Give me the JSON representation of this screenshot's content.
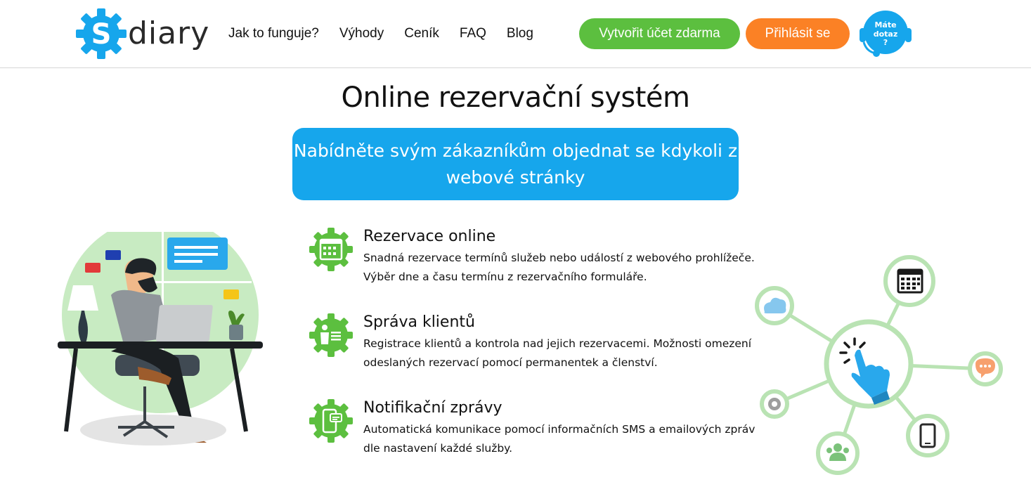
{
  "logo": {
    "letter": "S",
    "text": "diary"
  },
  "nav": {
    "items": [
      {
        "label": "Jak to funguje?"
      },
      {
        "label": "Výhody"
      },
      {
        "label": "Ceník"
      },
      {
        "label": "FAQ"
      },
      {
        "label": "Blog"
      }
    ]
  },
  "header": {
    "create_account_label": "Vytvořit účet zdarma",
    "login_label": "Přihlásit se",
    "help_badge": {
      "line1": "Máte",
      "line2": "dotaz",
      "line3": "?"
    }
  },
  "hero": {
    "title": "Online rezervační systém",
    "banner_line1": "Nabídněte svým zákazníkům objednat se kdykoli z",
    "banner_line2": "webové stránky"
  },
  "features": [
    {
      "icon": "calendar-icon",
      "title": "Rezervace online",
      "desc": "Snadná rezervace termínů služeb nebo událostí z webového prohlížeče. Výběr dne a času termínu z rezervačního formuláře."
    },
    {
      "icon": "client-list-icon",
      "title": "Správa klientů",
      "desc": "Registrace klientů a kontrola nad jejich rezervacemi. Možnosti omezení odeslaných rezervací pomocí permanentek a členství."
    },
    {
      "icon": "phone-message-icon",
      "title": "Notifikační zprávy",
      "desc": "Automatická komunikace pomocí informačních SMS a emailových zpráv dle nastavení každé služby."
    }
  ],
  "colors": {
    "brand_blue": "#16a6ec",
    "green": "#5cbf3f",
    "orange": "#fb8125",
    "light_green": "#b9e3b3"
  }
}
